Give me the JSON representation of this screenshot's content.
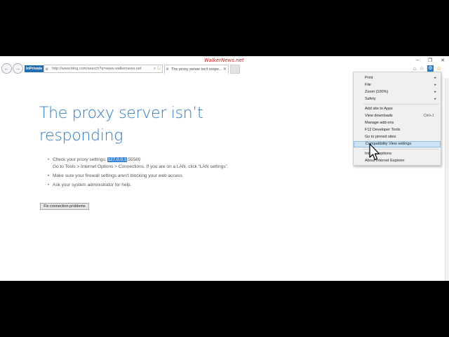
{
  "watermark": "WalkerNews.net",
  "window": {
    "minimize": "–",
    "maximize": "❐",
    "close": "✕"
  },
  "nav": {
    "back_glyph": "←",
    "forward_glyph": "→"
  },
  "inprivate_label": "InPrivate",
  "address": {
    "url": "http://www.bing.com/search?q=www.walkernews.net",
    "search_glyph": "⌕",
    "refresh_glyph": "↻"
  },
  "tab": {
    "title": "The proxy server isn't respo...",
    "close_glyph": "✕"
  },
  "toolbar_icons": {
    "home": "⌂",
    "favorites": "☆",
    "tools": "⚙",
    "feedback": "☺"
  },
  "error": {
    "title": "The proxy server isn’t responding",
    "bullet1_prefix": "Check your proxy settings: ",
    "proxy_highlight": "127.0.0.1",
    "proxy_rest": ":55580",
    "bullet1_line2": "Go to Tools > Internet Options > Connections. If you are on a LAN, click “LAN settings”.",
    "bullet2": "Make sure your firewall settings aren't blocking your web access.",
    "bullet3": "Ask your system administrator for help.",
    "fix_button": "Fix connection problems"
  },
  "tools_menu": {
    "print": "Print",
    "file": "File",
    "zoom": "Zoom (100%)",
    "safety": "Safety",
    "add_site": "Add site to Apps",
    "view_downloads": "View downloads",
    "view_downloads_shortcut": "Ctrl+J",
    "manage_addons": "Manage add-ons",
    "f12_tools": "F12 Developer Tools",
    "pinned_sites": "Go to pinned sites",
    "compat_view": "Compatibility View settings",
    "internet_options": "Internet options",
    "about_ie": "About Internet Explorer",
    "submenu_arrow": "▸"
  }
}
